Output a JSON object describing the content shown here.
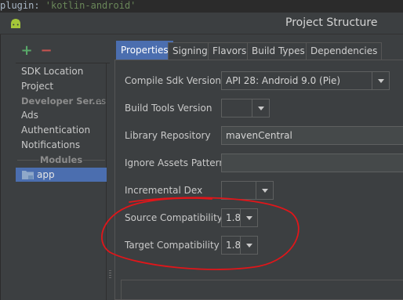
{
  "editor": {
    "code_prefix": "plugin: ",
    "code_string": "'kotlin-android'"
  },
  "window": {
    "title": "Project Structure",
    "app_icon": "android-icon"
  },
  "toolbar": {
    "add_label": "+",
    "remove_label": "−"
  },
  "sidebar": {
    "items": [
      {
        "label": "SDK Location"
      },
      {
        "label": "Project"
      }
    ],
    "developer_services_header": "Developer Ser...",
    "developer_services_suffix": "es",
    "services": [
      {
        "label": "Ads"
      },
      {
        "label": "Authentication"
      },
      {
        "label": "Notifications"
      }
    ],
    "modules_header": "Modules",
    "modules": [
      {
        "label": "app",
        "icon": "folder-icon",
        "selected": true
      }
    ]
  },
  "tabs": [
    {
      "label": "Properties",
      "active": true
    },
    {
      "label": "Signing"
    },
    {
      "label": "Flavors"
    },
    {
      "label": "Build Types"
    },
    {
      "label": "Dependencies"
    }
  ],
  "properties": {
    "compile_sdk": {
      "label": "Compile Sdk Version",
      "value": "API 28: Android 9.0 (Pie)"
    },
    "build_tools": {
      "label": "Build Tools Version",
      "value": ""
    },
    "library_repository": {
      "label": "Library Repository",
      "value": "mavenCentral"
    },
    "ignore_assets": {
      "label": "Ignore Assets Pattern",
      "value": ""
    },
    "incremental_dex": {
      "label": "Incremental Dex",
      "value": ""
    },
    "source_compat": {
      "label": "Source Compatibility",
      "value": "1.8"
    },
    "target_compat": {
      "label": "Target Compatibility",
      "value": "1.8"
    }
  },
  "colors": {
    "background": "#3c3f41",
    "selection": "#4b6eaf",
    "annotation": "#e0161a",
    "add": "#59a869",
    "remove": "#c75450"
  }
}
